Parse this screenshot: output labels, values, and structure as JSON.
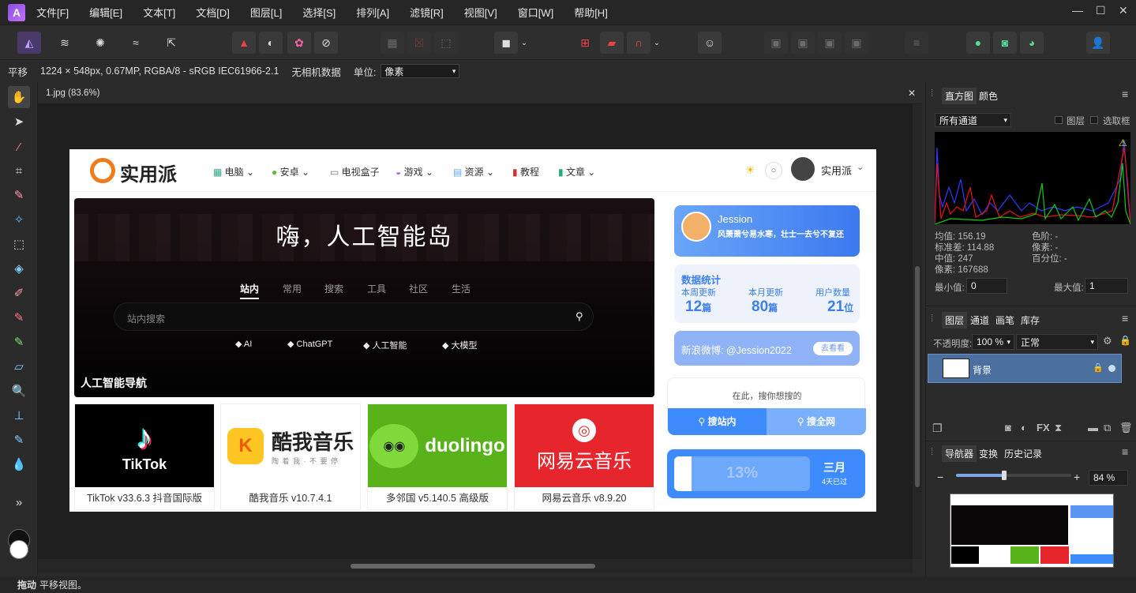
{
  "app": {
    "menu": [
      "文件[F]",
      "编辑[E]",
      "文本[T]",
      "文档[D]",
      "图层[L]",
      "选择[S]",
      "排列[A]",
      "滤镜[R]",
      "视图[V]",
      "窗口[W]",
      "帮助[H]"
    ],
    "window_controls": [
      "—",
      "☐",
      "✕"
    ]
  },
  "context_bar": {
    "tool": "平移",
    "info": "1224 × 548px, 0.67MP, RGBA/8 - sRGB IEC61966-2.1",
    "camera": "无相机数据",
    "unit_label": "单位:",
    "unit_value": "像素"
  },
  "document": {
    "tab": "1.jpg (83.6%)",
    "close": "✕"
  },
  "status": {
    "action": "拖动",
    "hint": "平移视图。"
  },
  "webpage": {
    "logo": "实用派",
    "nav": [
      "电脑",
      "安卓",
      "电视盒子",
      "游戏",
      "资源",
      "教程",
      "文章"
    ],
    "user": "实用派",
    "hero_title": "嗨，人工智能岛",
    "hero_tabs": [
      "站内",
      "常用",
      "搜索",
      "工具",
      "社区",
      "生活"
    ],
    "search_placeholder": "站内搜索",
    "keywords": [
      "AI",
      "ChatGPT",
      "人工智能",
      "大模型"
    ],
    "hero_caption": "人工智能导航",
    "profile": {
      "name": "Jession",
      "motto": "风萧萧兮易水寒，壮士一去兮不复还"
    },
    "stats": {
      "title": "数据统计",
      "items": [
        {
          "label": "本周更新",
          "value": "12",
          "unit": "篇"
        },
        {
          "label": "本月更新",
          "value": "80",
          "unit": "篇"
        },
        {
          "label": "用户数量",
          "value": "21",
          "unit": "位"
        }
      ]
    },
    "weibo": {
      "text": "新浪微博: @Jession2022",
      "button": "去看看"
    },
    "search_box": {
      "placeholder": "在此，搜你想搜的",
      "btn1": "搜站内",
      "btn2": "搜全网"
    },
    "progress": {
      "percent_label": "13%",
      "percent": 0.13,
      "month": "三月",
      "days": "4天已过"
    },
    "apps": [
      {
        "label": "TikTok v33.6.3 抖音国际版",
        "logo": "TikTok"
      },
      {
        "label": "酷我音乐 v10.7.4.1",
        "logo": "酷我音乐",
        "sub": "陶 着 我 · 不 要 停"
      },
      {
        "label": "多邻国 v5.140.5 高级版",
        "logo": "duolingo"
      },
      {
        "label": "网易云音乐 v8.9.20",
        "logo": "网易云音乐"
      }
    ]
  },
  "panels": {
    "histogram": {
      "tabs": [
        "直方图",
        "颜色"
      ],
      "channel": "所有通道",
      "chk_layer": "图层",
      "chk_sel": "选取框",
      "stats_left": [
        "均值: 156.19",
        "标准差: 114.88",
        "中值: 247",
        "像素: 167688"
      ],
      "stats_right": [
        "色阶: -",
        "像素: -",
        "百分位: -"
      ],
      "min_label": "最小值:",
      "min_value": "0",
      "max_label": "最大值:",
      "max_value": "1"
    },
    "layers": {
      "tabs": [
        "图层",
        "通道",
        "画笔",
        "库存"
      ],
      "opacity_label": "不透明度:",
      "opacity_value": "100 %",
      "blend": "正常",
      "layer_name": "背景"
    },
    "navigator": {
      "tabs": [
        "导航器",
        "变换",
        "历史记录"
      ],
      "zoom": "84 %"
    }
  },
  "colors": {
    "accent": "#3d8bfd",
    "selected_layer": "#4b6f9e"
  }
}
